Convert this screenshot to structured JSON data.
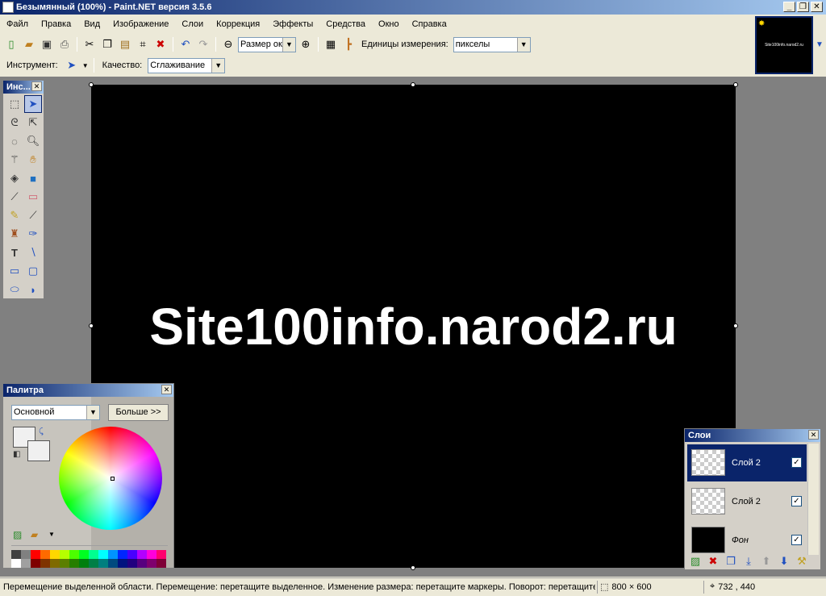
{
  "window": {
    "title": "Безымянный (100%) - Paint.NET версия 3.5.6"
  },
  "menu": {
    "items": [
      "Файл",
      "Правка",
      "Вид",
      "Изображение",
      "Слои",
      "Коррекция",
      "Эффекты",
      "Средства",
      "Окно",
      "Справка"
    ]
  },
  "toolbar": {
    "zoom_value": "Размер окн",
    "units_label": "Единицы измерения:",
    "units_value": "пикселы",
    "tool_label": "Инструмент:",
    "quality_label": "Качество:",
    "quality_value": "Сглаживание"
  },
  "thumbnail": {
    "text": "Site100info.narod2.ru"
  },
  "canvas": {
    "text": "Site100info.narod2.ru",
    "background": "#000000",
    "text_color": "#ffffff"
  },
  "tools_panel": {
    "title": "Инс..."
  },
  "palette": {
    "title": "Палитра",
    "mode": "Основной",
    "more_button": "Больше >>",
    "swatches_row1": [
      "#404040",
      "#808080",
      "#ff0000",
      "#ff6a00",
      "#ffd800",
      "#b6ff00",
      "#4cff00",
      "#00ff21",
      "#00ff90",
      "#00ffff",
      "#0094ff",
      "#0026ff",
      "#4800ff",
      "#b200ff",
      "#ff00dc",
      "#ff006e"
    ],
    "swatches_row2": [
      "#ffffff",
      "#a0a0a0",
      "#7f0000",
      "#7f3300",
      "#7f6a00",
      "#5b7f00",
      "#267f00",
      "#007f0e",
      "#007f46",
      "#007f7f",
      "#004a7f",
      "#00137f",
      "#21007f",
      "#57007f",
      "#7f006e",
      "#7f0037"
    ]
  },
  "layers": {
    "title": "Слои",
    "items": [
      {
        "name": "Слой 2",
        "visible": true,
        "selected": true
      },
      {
        "name": "Слой 2",
        "visible": true,
        "selected": false
      },
      {
        "name": "Фон",
        "visible": true,
        "selected": false
      }
    ]
  },
  "status": {
    "message": "Перемещение выделенной области. Перемещение: перетащите выделенное. Изменение размера: перетащите маркеры. Поворот: перетащите",
    "image_size": "800 × 600",
    "cursor_pos": "732 , 440"
  }
}
